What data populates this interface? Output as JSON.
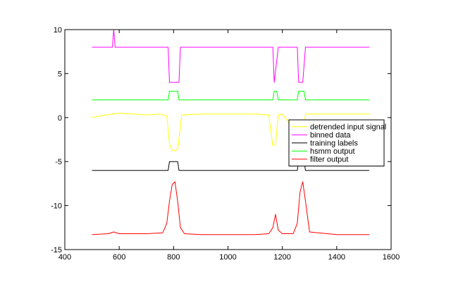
{
  "chart_data": {
    "type": "line",
    "title": "",
    "xlabel": "",
    "ylabel": "",
    "xlim": [
      400,
      1600
    ],
    "ylim": [
      -15,
      10
    ],
    "xticks": [
      400,
      600,
      800,
      1000,
      1200,
      1400,
      1600
    ],
    "yticks": [
      -15,
      -10,
      -5,
      0,
      5,
      10
    ],
    "grid": false,
    "legend_position": "right",
    "events": [
      {
        "start": 780,
        "end": 820
      },
      {
        "start": 1165,
        "end": 1185
      },
      {
        "start": 1255,
        "end": 1285
      }
    ],
    "series": [
      {
        "name": "detrended input signal",
        "color": "#ffff00",
        "x": [
          500,
          550,
          600,
          650,
          700,
          750,
          775,
          785,
          795,
          805,
          815,
          830,
          900,
          1000,
          1100,
          1150,
          1165,
          1175,
          1185,
          1200,
          1255,
          1265,
          1275,
          1285,
          1300,
          1400,
          1520
        ],
        "y": [
          0.0,
          0.3,
          0.5,
          0.4,
          0.3,
          0.4,
          0.2,
          -3.0,
          -3.7,
          -3.8,
          -3.6,
          0.3,
          0.4,
          0.4,
          0.4,
          0.3,
          -3.2,
          -3.0,
          0.3,
          0.4,
          -1.8,
          -3.2,
          -2.5,
          0.4,
          0.4,
          0.4,
          0.4
        ]
      },
      {
        "name": "binned data",
        "color": "#ff00ff",
        "x": [
          500,
          575,
          580,
          585,
          780,
          785,
          800,
          820,
          825,
          1165,
          1170,
          1185,
          1255,
          1260,
          1275,
          1285,
          1520
        ],
        "y": [
          8,
          8,
          10,
          8,
          8,
          4,
          4,
          4,
          8,
          8,
          4,
          8,
          8,
          4,
          4,
          8,
          8
        ]
      },
      {
        "name": "training labels",
        "color": "#000000",
        "x": [
          500,
          780,
          785,
          815,
          820,
          1255,
          1260,
          1280,
          1285,
          1520
        ],
        "y": [
          -6,
          -6,
          -5,
          -5,
          -6,
          -6,
          -5,
          -5,
          -6,
          -6
        ]
      },
      {
        "name": "hsmm output",
        "color": "#00ff00",
        "x": [
          500,
          780,
          785,
          815,
          820,
          1165,
          1170,
          1180,
          1185,
          1255,
          1260,
          1280,
          1285,
          1520
        ],
        "y": [
          2,
          2,
          3,
          3,
          2,
          2,
          3,
          3,
          2,
          2,
          3,
          3,
          2,
          2
        ]
      },
      {
        "name": "filter output",
        "color": "#ff0000",
        "x": [
          500,
          560,
          580,
          600,
          700,
          760,
          775,
          785,
          795,
          805,
          815,
          825,
          840,
          900,
          1100,
          1150,
          1165,
          1175,
          1185,
          1200,
          1240,
          1255,
          1265,
          1275,
          1285,
          1300,
          1400,
          1520
        ],
        "y": [
          -13.3,
          -13.2,
          -13.0,
          -13.2,
          -13.2,
          -13.1,
          -12.0,
          -9.5,
          -7.6,
          -7.3,
          -9.5,
          -12.5,
          -13.2,
          -13.3,
          -13.3,
          -13.2,
          -12.5,
          -11.0,
          -12.8,
          -13.2,
          -13.2,
          -12.0,
          -8.5,
          -7.3,
          -9.5,
          -13.0,
          -13.3,
          -13.3
        ]
      }
    ]
  }
}
